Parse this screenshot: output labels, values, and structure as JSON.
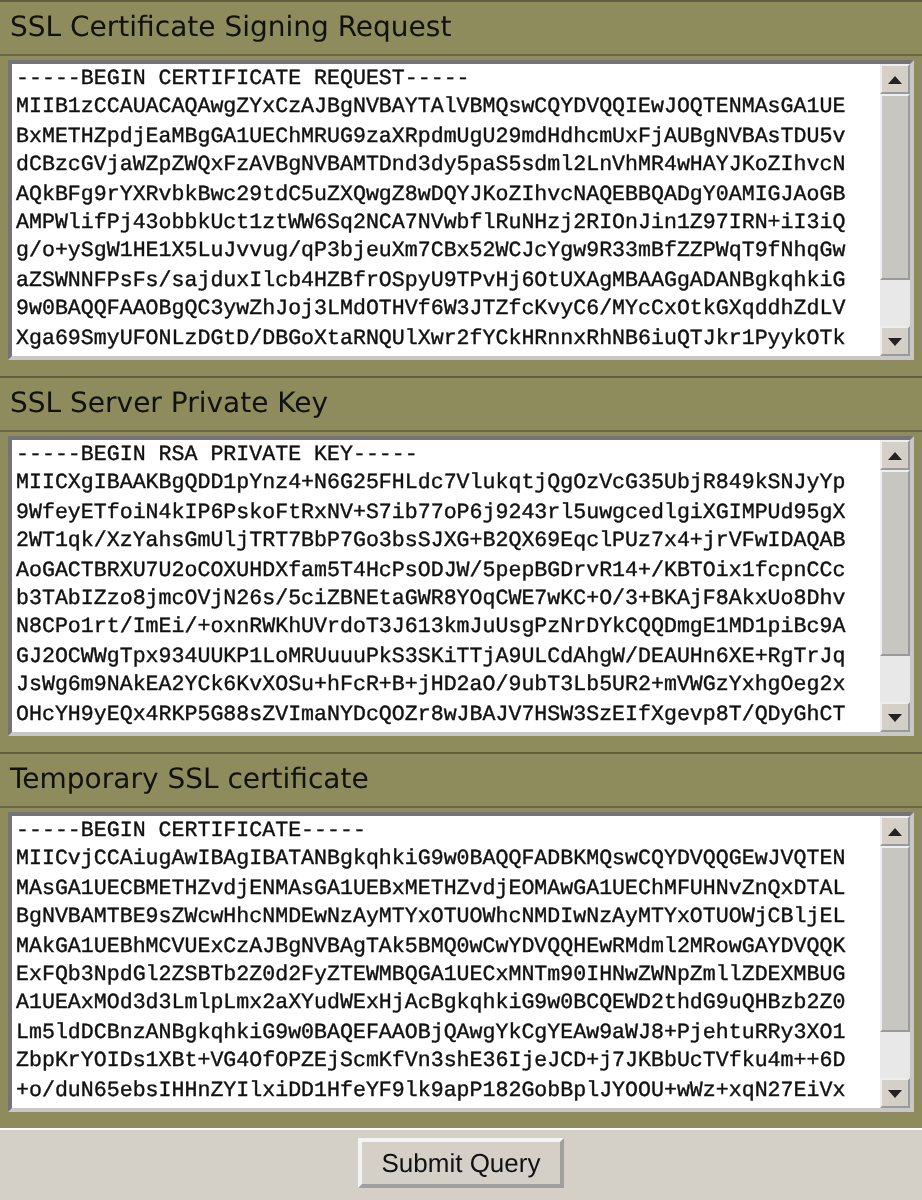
{
  "sections": [
    {
      "title": "SSL Certificate Signing Request",
      "lines": [
        "-----BEGIN CERTIFICATE REQUEST-----",
        "MIIB1zCCAUACAQAwgZYxCzAJBgNVBAYTAlVBMQswCQYDVQQIEwJOQTENMAsGA1UE",
        "BxMETHZpdjEaMBgGA1UEChMRUG9zaXRpdmUgU29mdHdhcmUxFjAUBgNVBAsTDU5v",
        "dCBzcGVjaWZpZWQxFzAVBgNVBAMTDnd3dy5paS5sdml2LnVhMR4wHAYJKoZIhvcN",
        "AQkBFg9rYXRvbkBwc29tdC5uZXQwgZ8wDQYJKoZIhvcNAQEBBQADgY0AMIGJAoGB",
        "AMPWlifPj43obbkUct1ztWW6Sq2NCA7NVwbflRuNHzj2RIOnJin1Z97IRN+iI3iQ",
        "g/o+ySgW1HE1X5LuJvvug/qP3bjeuXm7CBx52WCJcYgw9R33mBfZZPWqT9fNhqGw",
        "aZSWNNFPsFs/sajduxIlcb4HZBfrOSpyU9TPvHj6OtUXAgMBAAGgADANBgkqhkiG",
        "9w0BAQQFAAOBgQC3ywZhJoj3LMdOTHVf6W3JTZfcKvyC6/MYcCxOtkGXqddhZdLV",
        "Xga69SmyUFONLzDGtD/DBGoXtaRNQUlXwr2fYCkHRnnxRhNB6iuQTJkr1PyykOTk"
      ]
    },
    {
      "title": "SSL Server Private Key",
      "lines": [
        "-----BEGIN RSA PRIVATE KEY-----",
        "MIICXgIBAAKBgQDD1pYnz4+N6G25FHLdc7VlukqtjQgOzVcG35UbjR849kSNJyYp",
        "9WfeyETfoiN4kIP6PskoFtRxNV+S7ib77oP6j9243rl5uwgcedlgiXGIMPUd95gX",
        "2WT1qk/XzYahsGmUljTRT7BbP7Go3bsSJXG+B2QX69EqclPUz7x4+jrVFwIDAQAB",
        "AoGACTBRXU7U2oCOXUHDXfam5T4HcPsODJW/5pepBGDrvR14+/KBTOix1fcpnCCc",
        "b3TAbIZzo8jmcOVjN26s/5ciZBNEtaGWR8YOqCWE7wKC+O/3+BKAjF8AkxUo8Dhv",
        "N8CPo1rt/ImEi/+oxnRWKhUVrdoT3J613kmJuUsgPzNrDYkCQQDmgE1MD1piBc9A",
        "GJ2OCWWgTpx934UUKP1LoMRUuuuPkS3SKiTTjA9ULCdAhgW/DEAUHn6XE+RgTrJq",
        "JsWg6m9NAkEA2YCk6KvXOSu+hFcR+B+jHD2aO/9ubT3Lb5UR2+mVWGzYxhgOeg2x",
        "OHcYH9yEQx4RKP5G88sZVImaNYDcQOZr8wJBAJV7HSW3SzEIfXgevp8T/QDyGhCT"
      ]
    },
    {
      "title": "Temporary SSL certificate",
      "lines": [
        "-----BEGIN CERTIFICATE-----",
        "MIICvjCCAiugAwIBAgIBATANBgkqhkiG9w0BAQQFADBKMQswCQYDVQQGEwJVQTEN",
        "MAsGA1UECBMETHZvdjENMAsGA1UEBxMETHZvdjEOMAwGA1UEChMFUHNvZnQxDTAL",
        "BgNVBAMTBE9sZWcwHhcNMDEwNzAyMTYxOTUOWhcNMDIwNzAyMTYxOTUOWjCBljEL",
        "MAkGA1UEBhMCVUExCzAJBgNVBAgTAk5BMQ0wCwYDVQQHEwRMdml2MRowGAYDVQQK",
        "ExFQb3NpdGl2ZSBTb2Z0d2FyZTEWMBQGA1UECxMNTm90IHNwZWNpZmllZDEXMBUG",
        "A1UEAxMOd3d3LmlpLmx2aXYudWExHjAcBgkqhkiG9w0BCQEWD2thdG9uQHBzb2Z0",
        "Lm5ldDCBnzANBgkqhkiG9w0BAQEFAAOBjQAwgYkCgYEAw9aWJ8+PjehtuRRy3XO1",
        "ZbpKrYOIDs1XBt+VG4OfOPZEjScmKfVn3shE36IjeJCD+j7JKBbUcTVfku4m++6D",
        "+o/duN65ebsIHHnZYIlxiDD1HfeYF9lk9apP182GobBplJYOOU+wWz+xqN27EiVx"
      ]
    }
  ],
  "submit_button": "Submit Query"
}
